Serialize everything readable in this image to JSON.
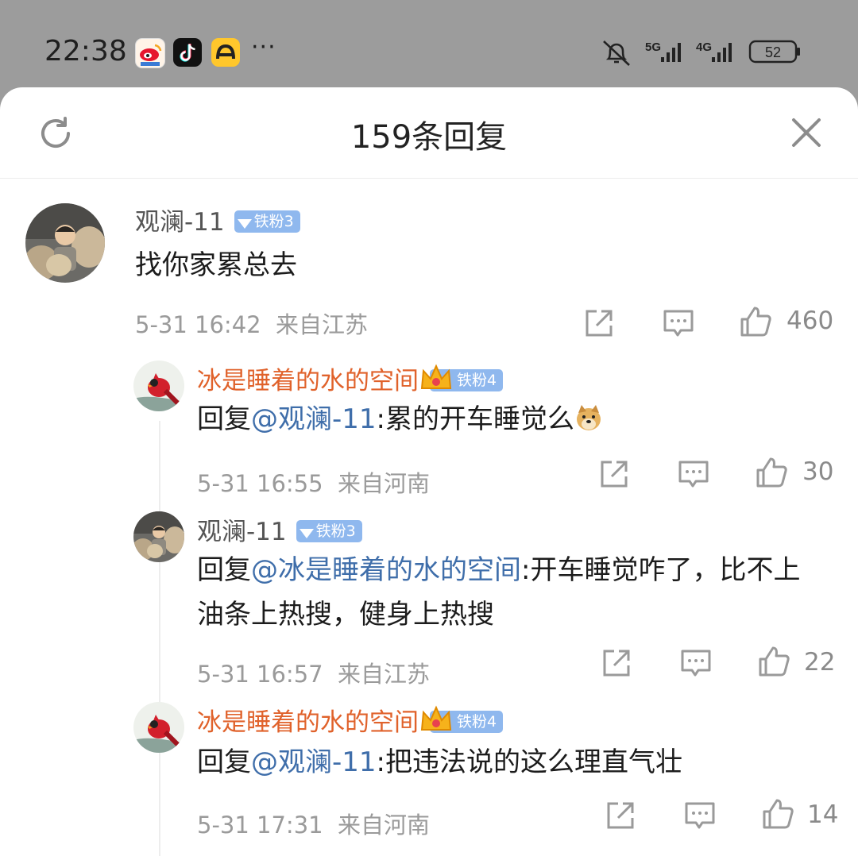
{
  "status_bar": {
    "time": "22:38",
    "more": "···",
    "network_1": "5G",
    "network_2": "4G",
    "battery": "52"
  },
  "sheet": {
    "title": "159条回复"
  },
  "main_comment": {
    "author": "观澜-11",
    "badge": "铁粉3",
    "text": "找你家累总去",
    "time": "5-31 16:42",
    "location": "来自江苏",
    "likes": "460"
  },
  "replies": [
    {
      "author": "冰是睡着的水的空间",
      "badge": "铁粉4",
      "prefix": "回复",
      "mention": "@观澜-11",
      "text": ":累的开车睡觉么",
      "time": "5-31 16:55",
      "location": "来自河南",
      "likes": "30"
    },
    {
      "author": "观澜-11",
      "badge": "铁粉3",
      "prefix": "回复",
      "mention": "@冰是睡着的水的空间",
      "text": ":开车睡觉咋了，比不上油条上热搜，健身上热搜",
      "time": "5-31 16:57",
      "location": "来自江苏",
      "likes": "22"
    },
    {
      "author": "冰是睡着的水的空间",
      "badge": "铁粉4",
      "prefix": "回复",
      "mention": "@观澜-11",
      "text": ":把违法说的这么理直气壮",
      "time": "5-31 17:31",
      "location": "来自河南",
      "likes": "14"
    }
  ],
  "icons": {
    "refresh": "refresh-icon",
    "close": "close-icon",
    "share": "share-icon",
    "comment": "comment-icon",
    "like": "thumbs-up-icon"
  },
  "colors": {
    "mention": "#3f6eaa",
    "orange_name": "#e0622b",
    "badge": "#8fb8ee"
  }
}
